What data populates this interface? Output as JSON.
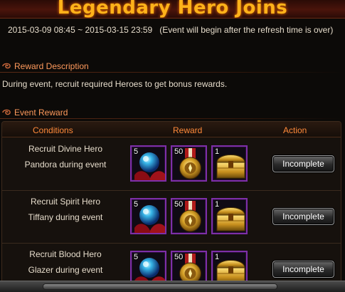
{
  "title": "Legendary Hero Joins",
  "period": {
    "start": "2015-03-09 08:45",
    "separator": "~",
    "end": "2015-03-15 23:59",
    "note": "(Event will begin after the refresh time is over)"
  },
  "reward_description": {
    "heading": "Reward Description",
    "text": "During event, recruit required Heroes to get bonus rewards."
  },
  "event_reward": {
    "heading": "Event Reward",
    "columns": {
      "conditions": "Conditions",
      "reward": "Reward",
      "action": "Action"
    },
    "rows": [
      {
        "line1": "Recruit Divine Hero",
        "line2": "Pandora during event",
        "rewards": [
          {
            "qty": "5",
            "icon": "blue-orb-icon"
          },
          {
            "qty": "50",
            "icon": "gold-medal-icon"
          },
          {
            "qty": "1",
            "icon": "treasure-chest-icon"
          }
        ],
        "action": "Incomplete"
      },
      {
        "line1": "Recruit Spirit Hero",
        "line2": "Tiffany during event",
        "rewards": [
          {
            "qty": "5",
            "icon": "blue-orb-icon"
          },
          {
            "qty": "50",
            "icon": "gold-medal-icon"
          },
          {
            "qty": "1",
            "icon": "treasure-chest-icon"
          }
        ],
        "action": "Incomplete"
      },
      {
        "line1": "Recruit Blood Hero",
        "line2": "Glazer during event",
        "rewards": [
          {
            "qty": "5",
            "icon": "blue-orb-icon"
          },
          {
            "qty": "50",
            "icon": "gold-medal-icon"
          },
          {
            "qty": "1",
            "icon": "treasure-chest-icon"
          }
        ],
        "action": "Incomplete"
      }
    ]
  },
  "colors": {
    "title": "#ffb21a",
    "section_heading": "#ff9a5c",
    "column_heading": "#ff8a3a",
    "icon_border": "#7d2fa8"
  }
}
